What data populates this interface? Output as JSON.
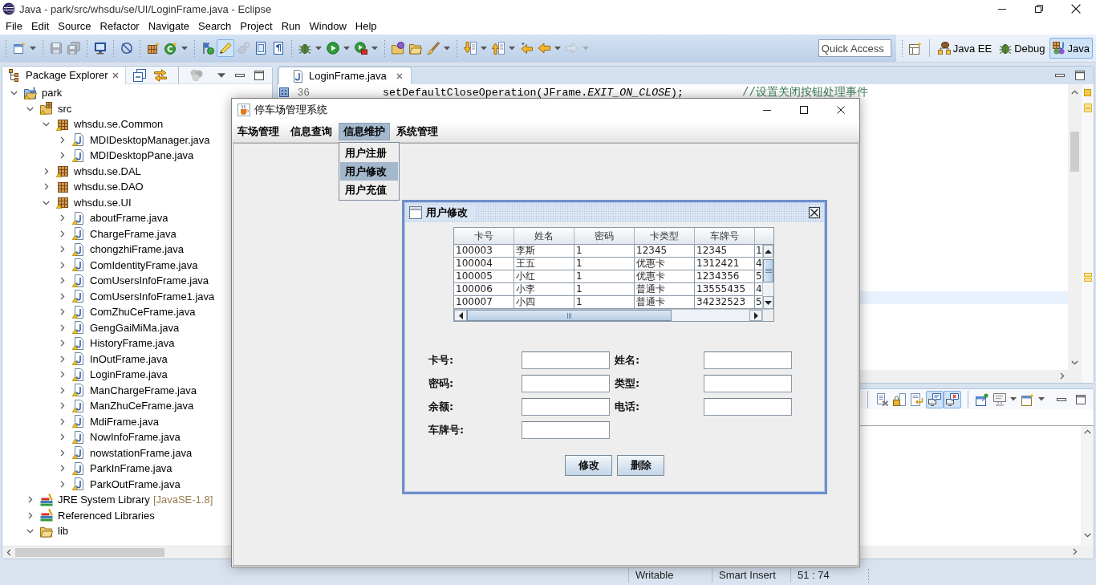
{
  "window": {
    "title": "Java - park/src/whsdu/se/UI/LoginFrame.java - Eclipse"
  },
  "menu_bar": [
    "File",
    "Edit",
    "Source",
    "Refactor",
    "Navigate",
    "Search",
    "Project",
    "Run",
    "Window",
    "Help"
  ],
  "toolbar": {
    "groups": [
      {
        "buttons": [
          {
            "kind": "new",
            "selected": false,
            "disabled": false,
            "dropdown": true
          }
        ]
      },
      {
        "buttons": [
          {
            "kind": "save",
            "selected": false,
            "disabled": true,
            "dropdown": false
          },
          {
            "kind": "save-all",
            "selected": false,
            "disabled": true,
            "dropdown": false
          }
        ]
      },
      {
        "buttons": [
          {
            "kind": "terminal",
            "selected": false,
            "disabled": false,
            "dropdown": false
          }
        ]
      },
      {
        "buttons": [
          {
            "kind": "skip",
            "selected": false,
            "disabled": false,
            "dropdown": false
          }
        ]
      },
      {
        "buttons": [
          {
            "kind": "package",
            "selected": false,
            "disabled": false,
            "dropdown": false
          },
          {
            "kind": "class",
            "selected": false,
            "disabled": false,
            "dropdown": true
          }
        ]
      },
      {
        "buttons": [
          {
            "kind": "flag",
            "selected": false,
            "disabled": false,
            "dropdown": false
          },
          {
            "kind": "highlighter",
            "selected": true,
            "disabled": false,
            "dropdown": false
          },
          {
            "kind": "eraser",
            "selected": false,
            "disabled": true,
            "dropdown": false
          },
          {
            "kind": "doc",
            "selected": false,
            "disabled": false,
            "dropdown": false
          },
          {
            "kind": "pilcrow",
            "selected": false,
            "disabled": false,
            "dropdown": false
          }
        ]
      },
      {
        "buttons": [
          {
            "kind": "bug",
            "selected": false,
            "disabled": false,
            "dropdown": true
          },
          {
            "kind": "run",
            "selected": false,
            "disabled": false,
            "dropdown": true
          },
          {
            "kind": "run-ext",
            "selected": false,
            "disabled": false,
            "dropdown": true
          }
        ]
      },
      {
        "buttons": [
          {
            "kind": "open-type",
            "selected": false,
            "disabled": false,
            "dropdown": false
          },
          {
            "kind": "folder",
            "selected": false,
            "disabled": false,
            "dropdown": false
          },
          {
            "kind": "brush",
            "selected": false,
            "disabled": false,
            "dropdown": true
          }
        ]
      },
      {
        "buttons": [
          {
            "kind": "next",
            "selected": false,
            "disabled": false,
            "dropdown": true
          },
          {
            "kind": "prev",
            "selected": false,
            "disabled": false,
            "dropdown": true
          },
          {
            "kind": "last-edit",
            "selected": false,
            "disabled": false,
            "dropdown": false
          },
          {
            "kind": "back",
            "selected": false,
            "disabled": false,
            "dropdown": true
          },
          {
            "kind": "forward",
            "selected": false,
            "disabled": true,
            "dropdown": true
          }
        ]
      }
    ],
    "quick_access": {
      "placeholder": "Quick Access"
    },
    "perspectives": [
      {
        "kind": "java-ee",
        "label": "Java EE",
        "selected": false
      },
      {
        "kind": "debug",
        "label": "Debug",
        "selected": false
      },
      {
        "kind": "java",
        "label": "Java",
        "selected": true
      }
    ]
  },
  "package_explorer": {
    "title": "Package Explorer",
    "tree": [
      {
        "label": "park",
        "kind": "project",
        "warning": true,
        "expanded": true,
        "children": [
          {
            "label": "src",
            "kind": "source-folder",
            "warning": true,
            "expanded": true,
            "children": [
              {
                "label": "whsdu.se.Common",
                "kind": "package",
                "warning": true,
                "expanded": true,
                "children": [
                  {
                    "label": "MDIDesktopManager.java",
                    "kind": "java-file",
                    "warning": true,
                    "expanded": false
                  },
                  {
                    "label": "MDIDesktopPane.java",
                    "kind": "java-file",
                    "warning": true,
                    "expanded": false
                  }
                ]
              },
              {
                "label": "whsdu.se.DAL",
                "kind": "package",
                "warning": true,
                "expanded": false
              },
              {
                "label": "whsdu.se.DAO",
                "kind": "package",
                "warning": false,
                "expanded": false
              },
              {
                "label": "whsdu.se.UI",
                "kind": "package",
                "warning": true,
                "expanded": true,
                "children": [
                  {
                    "label": "aboutFrame.java",
                    "kind": "java-file",
                    "warning": true,
                    "expanded": false
                  },
                  {
                    "label": "ChargeFrame.java",
                    "kind": "java-file",
                    "warning": true,
                    "expanded": false
                  },
                  {
                    "label": "chongzhiFrame.java",
                    "kind": "java-file",
                    "warning": true,
                    "expanded": false
                  },
                  {
                    "label": "ComIdentityFrame.java",
                    "kind": "java-file",
                    "warning": true,
                    "expanded": false
                  },
                  {
                    "label": "ComUsersInfoFrame.java",
                    "kind": "java-file",
                    "warning": true,
                    "expanded": false
                  },
                  {
                    "label": "ComUsersInfoFrame1.java",
                    "kind": "java-file",
                    "warning": true,
                    "expanded": false
                  },
                  {
                    "label": "ComZhuCeFrame.java",
                    "kind": "java-file",
                    "warning": true,
                    "expanded": false
                  },
                  {
                    "label": "GengGaiMiMa.java",
                    "kind": "java-file",
                    "warning": true,
                    "expanded": false
                  },
                  {
                    "label": "HistoryFrame.java",
                    "kind": "java-file",
                    "warning": true,
                    "expanded": false
                  },
                  {
                    "label": "InOutFrame.java",
                    "kind": "java-file",
                    "warning": true,
                    "expanded": false
                  },
                  {
                    "label": "LoginFrame.java",
                    "kind": "java-file",
                    "warning": true,
                    "expanded": false
                  },
                  {
                    "label": "ManChargeFrame.java",
                    "kind": "java-file",
                    "warning": true,
                    "expanded": false
                  },
                  {
                    "label": "ManZhuCeFrame.java",
                    "kind": "java-file",
                    "warning": true,
                    "expanded": false
                  },
                  {
                    "label": "MdiFrame.java",
                    "kind": "java-file",
                    "warning": true,
                    "expanded": false
                  },
                  {
                    "label": "NowInfoFrame.java",
                    "kind": "java-file",
                    "warning": true,
                    "expanded": false
                  },
                  {
                    "label": "nowstationFrame.java",
                    "kind": "java-file",
                    "warning": true,
                    "expanded": false
                  },
                  {
                    "label": "ParkInFrame.java",
                    "kind": "java-file",
                    "warning": true,
                    "expanded": false
                  },
                  {
                    "label": "ParkOutFrame.java",
                    "kind": "java-file",
                    "warning": true,
                    "expanded": false
                  }
                ]
              }
            ]
          },
          {
            "label": "JRE System Library",
            "decoration": "[JavaSE-1.8]",
            "kind": "library",
            "warning": false,
            "expanded": false
          },
          {
            "label": "Referenced Libraries",
            "kind": "library",
            "warning": false,
            "expanded": false
          },
          {
            "label": "lib",
            "kind": "folder",
            "warning": false,
            "expanded": true
          }
        ]
      }
    ]
  },
  "editor": {
    "tabs": [
      {
        "label": "LoginFrame.java",
        "selected": true
      }
    ],
    "lines": [
      {
        "number": "36",
        "code": "setDefaultCloseOperation(JFrame.*EXIT_ON_CLOSE*);",
        "comment": "//设置关闭按钮处理事件"
      }
    ]
  },
  "bottom_panel": {
    "groups": [
      {
        "tools": [
          {
            "kind": "remove-doc",
            "selected": false,
            "dropdown": false
          },
          {
            "kind": "lock",
            "selected": false,
            "dropdown": false
          },
          {
            "kind": "wrap",
            "selected": false,
            "dropdown": false
          },
          {
            "kind": "show-out",
            "selected": true,
            "dropdown": false
          },
          {
            "kind": "show-err",
            "selected": true,
            "dropdown": false
          }
        ]
      },
      {
        "tools": [
          {
            "kind": "pin",
            "selected": false,
            "dropdown": false
          },
          {
            "kind": "display",
            "selected": false,
            "dropdown": true
          },
          {
            "kind": "new-console",
            "selected": false,
            "dropdown": true
          }
        ]
      }
    ]
  },
  "status_bar": [
    "Writable",
    "Smart Insert",
    "51 : 74"
  ],
  "app_window": {
    "title": "停车场管理系统",
    "menus": [
      {
        "label": "车场管理",
        "selected": false
      },
      {
        "label": "信息查询",
        "selected": false
      },
      {
        "label": "信息维护",
        "selected": true,
        "items": [
          {
            "label": "用户注册",
            "selected": false
          },
          {
            "label": "用户修改",
            "selected": true
          },
          {
            "label": "用户充值",
            "selected": false
          }
        ]
      },
      {
        "label": "系统管理",
        "selected": false
      }
    ],
    "internal_frame": {
      "title": "用户修改",
      "table": {
        "columns": [
          "卡号",
          "姓名",
          "密码",
          "卡类型",
          "车牌号"
        ],
        "rows": [
          [
            "100003",
            "李斯",
            "1",
            "12345",
            "12345",
            "1"
          ],
          [
            "100004",
            "王五",
            "1",
            "优惠卡",
            "1312421",
            "4"
          ],
          [
            "100005",
            "小红",
            "1",
            "优惠卡",
            "1234356",
            "5"
          ],
          [
            "100006",
            "小李",
            "1",
            "普通卡",
            "13555435",
            "4"
          ],
          [
            "100007",
            "小四",
            "1",
            "普通卡",
            "34232523",
            "5"
          ]
        ]
      },
      "fields": [
        {
          "label": "卡号:"
        },
        {
          "label": "姓名:"
        },
        {
          "label": "密码:"
        },
        {
          "label": "类型:"
        },
        {
          "label": "余额:"
        },
        {
          "label": "电话:"
        },
        {
          "label": "车牌号:"
        }
      ],
      "buttons": [
        "修改",
        "删除"
      ]
    }
  }
}
